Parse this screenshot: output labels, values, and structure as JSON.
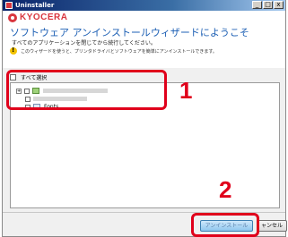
{
  "window": {
    "title": "Uninstaller",
    "min_symbol": "_",
    "max_symbol": "□",
    "close_symbol": "x"
  },
  "header": {
    "brand": "KYOCERA",
    "heading": "ソフトウェア アンインストールウィザードにようこそ",
    "instruction": "すべてのアプリケーションを閉じてから続行してください。",
    "warning": "このウィザードを使うと、プリンタドライバとソフトウェアを簡単にアンインストールできます。"
  },
  "list": {
    "select_all_label": "すべて選択",
    "items": [
      {
        "label": ""
      },
      {
        "label": ""
      },
      {
        "label": "Fonts"
      }
    ]
  },
  "annotations": {
    "step1": "1",
    "step2": "2"
  },
  "buttons": {
    "uninstall": "アンインストール",
    "cancel": "ャンセル"
  },
  "colors": {
    "brand": "#d9363e",
    "heading": "#1c5fb4",
    "annotation": "#e0001b"
  }
}
